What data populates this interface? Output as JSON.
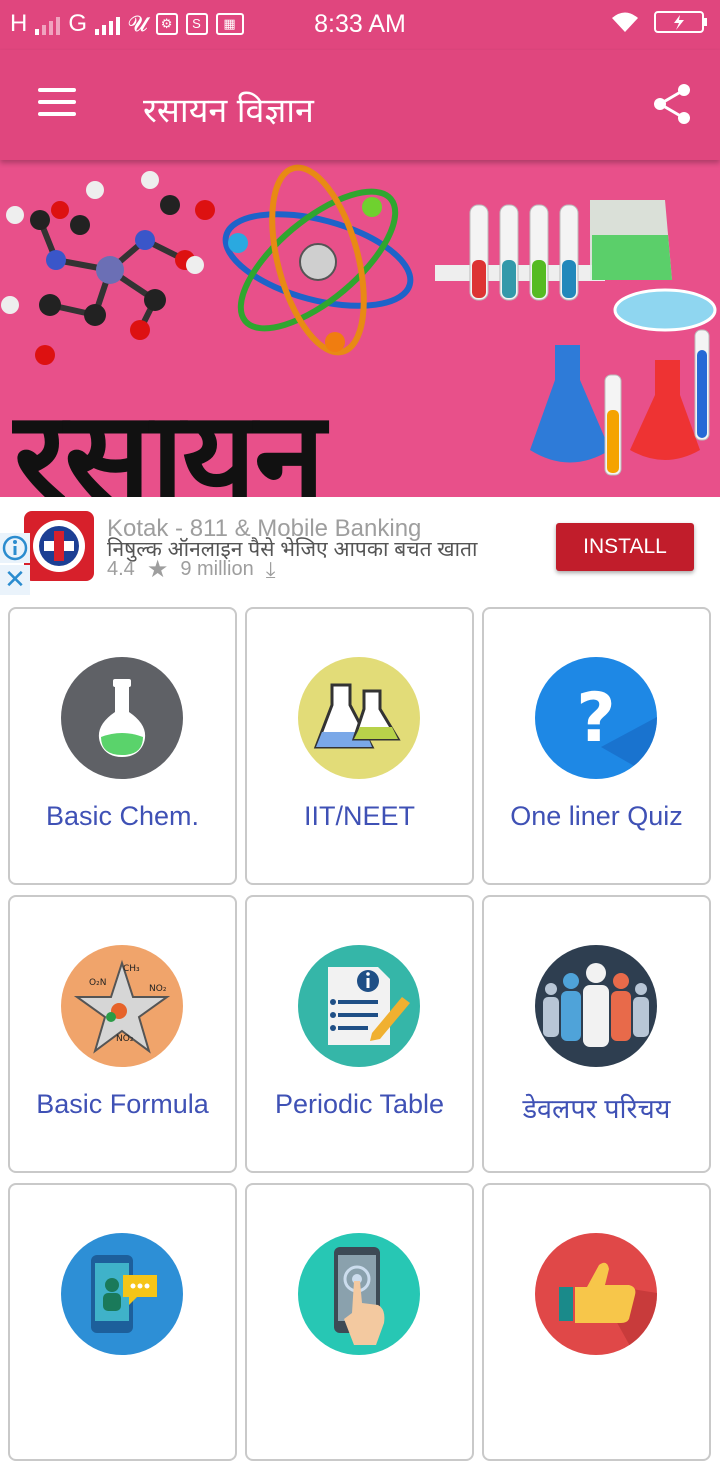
{
  "status_bar": {
    "carrier_h": "H",
    "carrier_g": "G",
    "time": "8:33 AM"
  },
  "app_bar": {
    "title": "रसायन विज्ञान",
    "menu_icon": "hamburger-menu-icon",
    "share_icon": "share-icon"
  },
  "banner": {
    "title": "रसायन"
  },
  "ad": {
    "title": "Kotak - 811 & Mobile Banking",
    "description": "निषुल्क ऑनलाइन पैसे भेजिए आपका बचत खाता",
    "rating": "4.4",
    "downloads": "9 million",
    "install_label": "INSTALL"
  },
  "tiles": [
    {
      "label": "Basic Chem.",
      "icon": "flask-icon",
      "color": "#5f6166"
    },
    {
      "label": "IIT/NEET",
      "icon": "beakers-icon",
      "color": "#e2dc78"
    },
    {
      "label": "One liner Quiz",
      "icon": "question-icon",
      "color": "#1e88e5"
    },
    {
      "label": "Basic Formula",
      "icon": "molecule-star-icon",
      "color": "#f0a46b"
    },
    {
      "label": "Periodic Table",
      "icon": "document-info-icon",
      "color": "#35b6a8"
    },
    {
      "label": "डेवलपर परिचय",
      "icon": "team-people-icon",
      "color": "#2e3e50"
    },
    {
      "label": "",
      "icon": "chat-phone-icon",
      "color": "#2d8fd6"
    },
    {
      "label": "",
      "icon": "touch-phone-icon",
      "color": "#27c7b4"
    },
    {
      "label": "",
      "icon": "thumbs-up-icon",
      "color": "#e04848"
    }
  ]
}
